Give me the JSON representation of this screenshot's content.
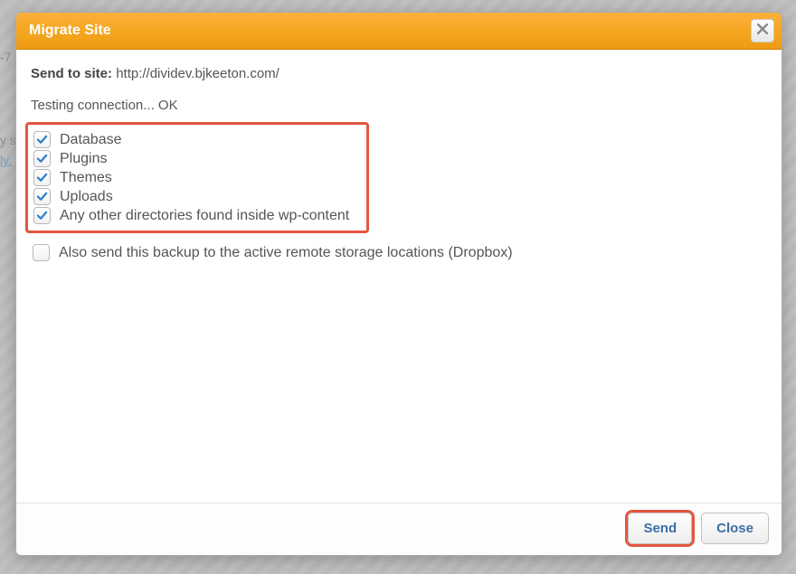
{
  "dialog": {
    "title": "Migrate Site",
    "send_to_label": "Send to site:",
    "send_to_url": "http://dividev.bjkeeton.com/",
    "connection_test": "Testing connection... OK"
  },
  "options": [
    {
      "label": "Database",
      "checked": true
    },
    {
      "label": "Plugins",
      "checked": true
    },
    {
      "label": "Themes",
      "checked": true
    },
    {
      "label": "Uploads",
      "checked": true
    },
    {
      "label": "Any other directories found inside wp-content",
      "checked": true
    }
  ],
  "remote_storage": {
    "label": "Also send this backup to the active remote storage locations (Dropbox)",
    "checked": false
  },
  "buttons": {
    "send": "Send",
    "close": "Close"
  },
  "background_peek": {
    "line1": "-7",
    "line2a": "y s",
    "line2b": "ly."
  },
  "icons": {
    "close": "close-icon",
    "check": "check-icon"
  }
}
